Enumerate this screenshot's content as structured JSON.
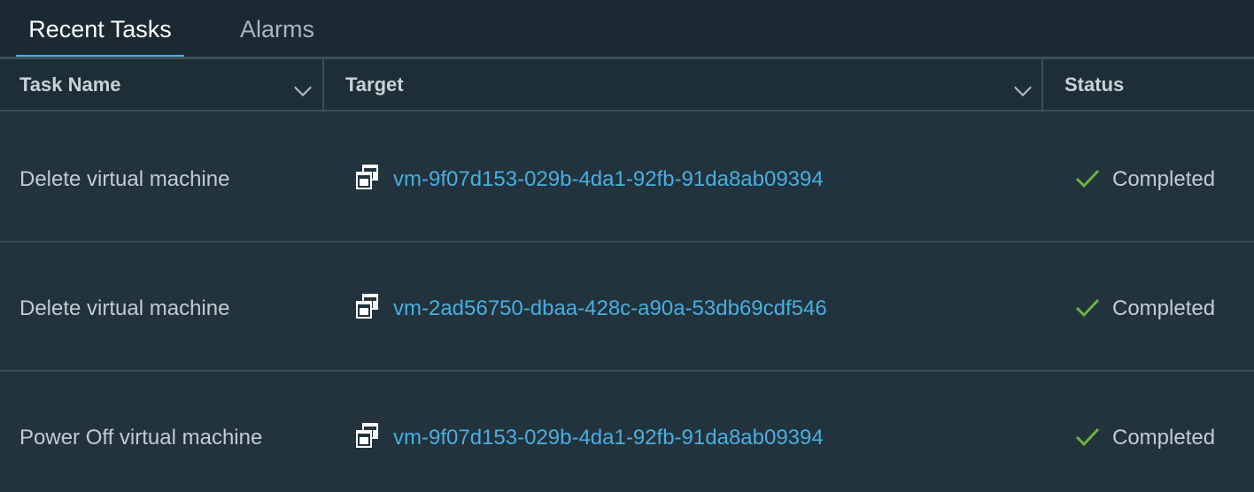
{
  "tabs": [
    {
      "label": "Recent Tasks",
      "active": true
    },
    {
      "label": "Alarms",
      "active": false
    }
  ],
  "columns": [
    {
      "label": "Task Name"
    },
    {
      "label": "Target"
    },
    {
      "label": "Status"
    }
  ],
  "rows": [
    {
      "task_name": "Delete virtual machine",
      "target": "vm-9f07d153-029b-4da1-92fb-91da8ab09394",
      "status": "Completed"
    },
    {
      "task_name": "Delete virtual machine",
      "target": "vm-2ad56750-dbaa-428c-a90a-53db69cdf546",
      "status": "Completed"
    },
    {
      "task_name": "Power Off virtual machine",
      "target": "vm-9f07d153-029b-4da1-92fb-91da8ab09394",
      "status": "Completed"
    }
  ],
  "icons": {
    "target": "virtual-machine-icon",
    "status": "check-icon"
  },
  "colors": {
    "accent": "#49aee0",
    "success": "#6db33f",
    "background": "#22333d"
  }
}
